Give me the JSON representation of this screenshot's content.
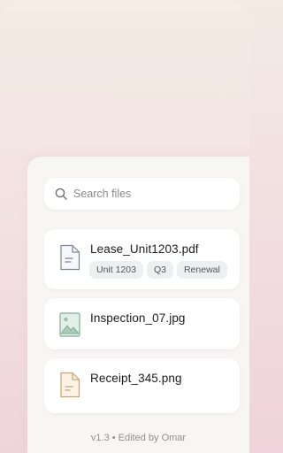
{
  "search": {
    "placeholder": "Search files",
    "icon": "search-icon"
  },
  "files": [
    {
      "name": "Lease_Unit1203.pdf",
      "icon": "document-icon",
      "tags": [
        "Unit 1203",
        "Q3",
        "Renewal"
      ]
    },
    {
      "name": "Inspection_07.jpg",
      "icon": "image-icon",
      "tags": []
    },
    {
      "name": "Receipt_345.png",
      "icon": "receipt-icon",
      "tags": []
    }
  ],
  "footer": {
    "text": "v1.3 • Edited by Omar"
  },
  "colors": {
    "pdf_icon": "#7a8596",
    "image_icon": "#7fae97",
    "receipt_icon": "#c9a36d"
  }
}
